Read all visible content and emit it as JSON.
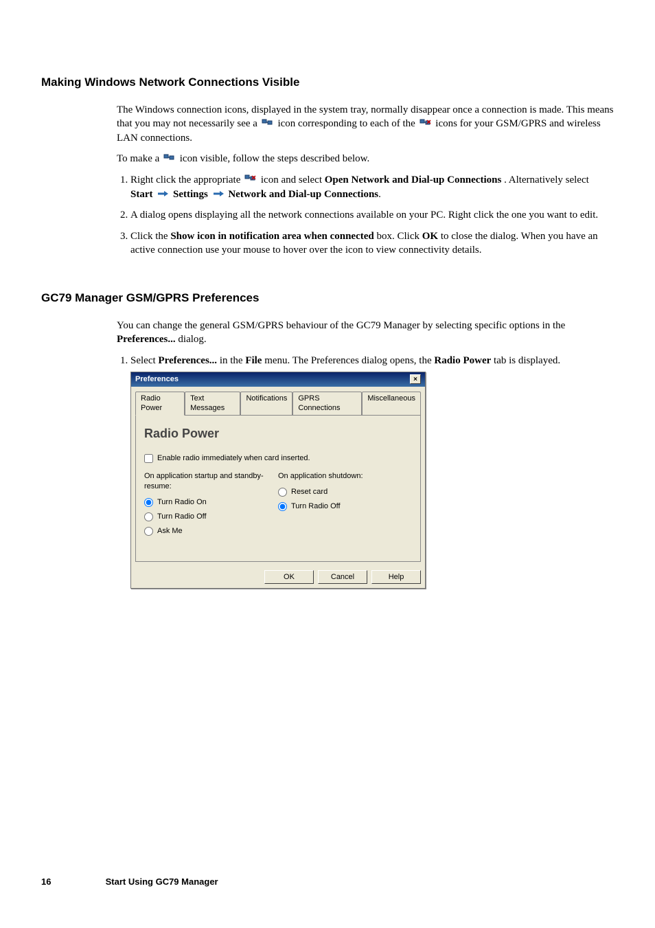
{
  "section1": {
    "heading": "Making Windows Network Connections Visible",
    "para1_pre": "The Windows connection icons, displayed in the system tray, normally disappear once a connection is made. This means that you may not necessarily see a ",
    "para1_mid": " icon corresponding to each of the ",
    "para1_post": " icons for your GSM/GPRS and wireless LAN connections.",
    "para2_pre": "To make a ",
    "para2_post": " icon visible, follow the steps described below.",
    "li1_pre": "Right click the appropriate ",
    "li1_mid1": " icon and select ",
    "li1_bold1": "Open Network and Dial-up Connections",
    "li1_mid2": ". Alternatively select ",
    "li1_bold2": "Start",
    "li1_bold3": "Settings",
    "li1_bold4": "Network and Dial-up Connections",
    "li1_end": ".",
    "li2": "A dialog opens displaying all the network connections available on your PC. Right click the one you want to edit.",
    "li3_a": "Click the ",
    "li3_bold1": "Show icon in notification area when connected",
    "li3_b": " box. Click ",
    "li3_bold2": "OK",
    "li3_c": " to close the dialog. When you have an active connection use your mouse to hover over the icon to view connectivity details."
  },
  "section2": {
    "heading": "GC79 Manager GSM/GPRS Preferences",
    "para1_a": "You can change the general GSM/GPRS behaviour of the GC79 Manager by selecting specific options in the ",
    "para1_bold": "Preferences...",
    "para1_b": " dialog.",
    "li1_a": "Select ",
    "li1_bold1": "Preferences...",
    "li1_b": " in the ",
    "li1_bold2": "File",
    "li1_c": " menu. The Preferences dialog opens, the ",
    "li1_bold3": "Radio Power",
    "li1_d": " tab is displayed."
  },
  "dialog": {
    "title": "Preferences",
    "tabs": [
      "Radio Power",
      "Text Messages",
      "Notifications",
      "GPRS Connections",
      "Miscellaneous"
    ],
    "panel_heading": "Radio Power",
    "checkbox_label": "Enable radio immediately when card inserted.",
    "left_label": "On application startup and standby-resume:",
    "right_label": "On application shutdown:",
    "left_opts": [
      "Turn Radio On",
      "Turn Radio Off",
      "Ask Me"
    ],
    "right_opts": [
      "Reset card",
      "Turn Radio Off"
    ],
    "buttons": {
      "ok": "OK",
      "cancel": "Cancel",
      "help": "Help"
    }
  },
  "footer": {
    "page": "16",
    "title": "Start Using GC79 Manager"
  }
}
